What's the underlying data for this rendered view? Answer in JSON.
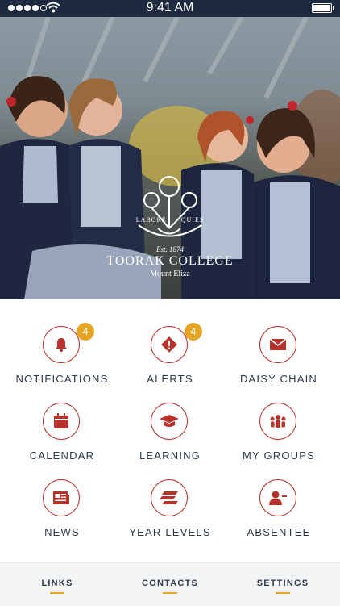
{
  "status_bar": {
    "time": "9:41 AM"
  },
  "hero": {
    "crest_motto_left": "LABORE",
    "crest_motto_right": "QUIES",
    "est": "Est. 1874",
    "school_name": "TOORAK COLLEGE",
    "campus": "Mount Eliza"
  },
  "tiles": [
    {
      "label": "NOTIFICATIONS",
      "icon": "bell-icon",
      "badge": "4"
    },
    {
      "label": "ALERTS",
      "icon": "alert-icon",
      "badge": "4"
    },
    {
      "label": "DAISY CHAIN",
      "icon": "envelope-icon"
    },
    {
      "label": "CALENDAR",
      "icon": "calendar-icon"
    },
    {
      "label": "LEARNING",
      "icon": "graduation-cap-icon"
    },
    {
      "label": "MY GROUPS",
      "icon": "group-icon"
    },
    {
      "label": "NEWS",
      "icon": "newspaper-icon"
    },
    {
      "label": "YEAR LEVELS",
      "icon": "layers-icon"
    },
    {
      "label": "ABSENTEE",
      "icon": "user-minus-icon"
    }
  ],
  "bottom_nav": [
    {
      "label": "LINKS"
    },
    {
      "label": "CONTACTS"
    },
    {
      "label": "SETTINGS"
    }
  ],
  "colors": {
    "accent": "#b8322c",
    "badge": "#e5a422",
    "text": "#2d3a4a",
    "status_bar": "#1d2a3f"
  }
}
